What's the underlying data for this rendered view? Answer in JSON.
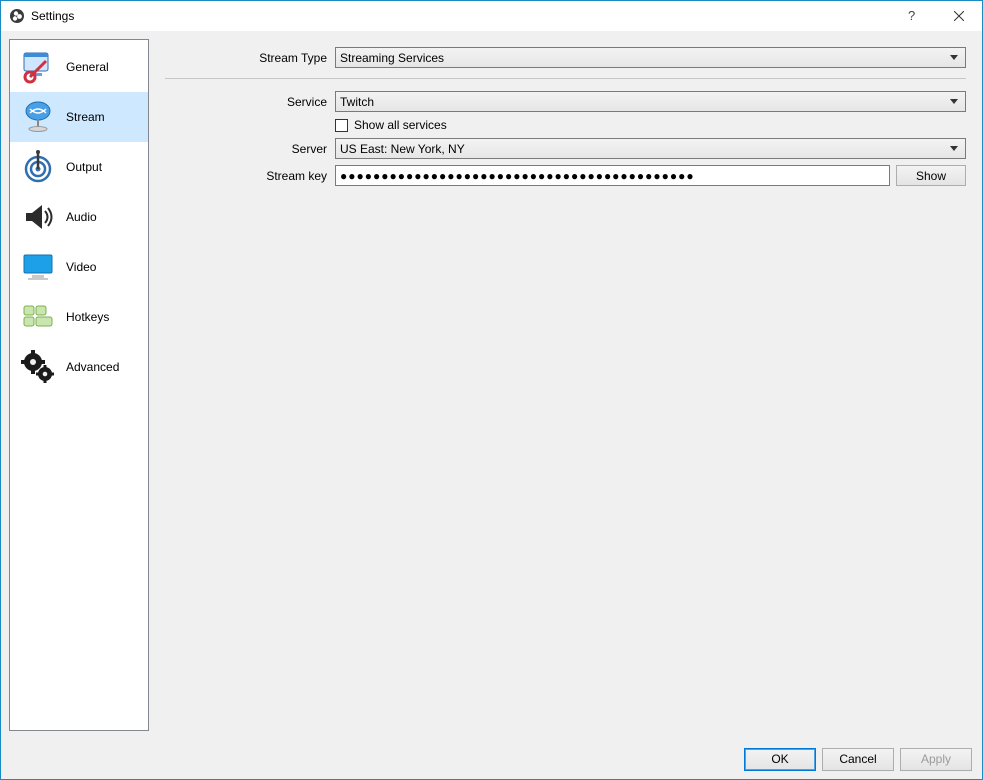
{
  "window": {
    "title": "Settings"
  },
  "sidebar": {
    "items": [
      {
        "label": "General"
      },
      {
        "label": "Stream"
      },
      {
        "label": "Output"
      },
      {
        "label": "Audio"
      },
      {
        "label": "Video"
      },
      {
        "label": "Hotkeys"
      },
      {
        "label": "Advanced"
      }
    ],
    "selected_index": 1
  },
  "form": {
    "stream_type_label": "Stream Type",
    "stream_type_value": "Streaming Services",
    "service_label": "Service",
    "service_value": "Twitch",
    "show_all_services_label": "Show all services",
    "show_all_services_checked": false,
    "server_label": "Server",
    "server_value": "US East: New York, NY",
    "stream_key_label": "Stream key",
    "stream_key_value": "●●●●●●●●●●●●●●●●●●●●●●●●●●●●●●●●●●●●●●●●●●●",
    "show_button": "Show"
  },
  "footer": {
    "ok": "OK",
    "cancel": "Cancel",
    "apply": "Apply"
  }
}
